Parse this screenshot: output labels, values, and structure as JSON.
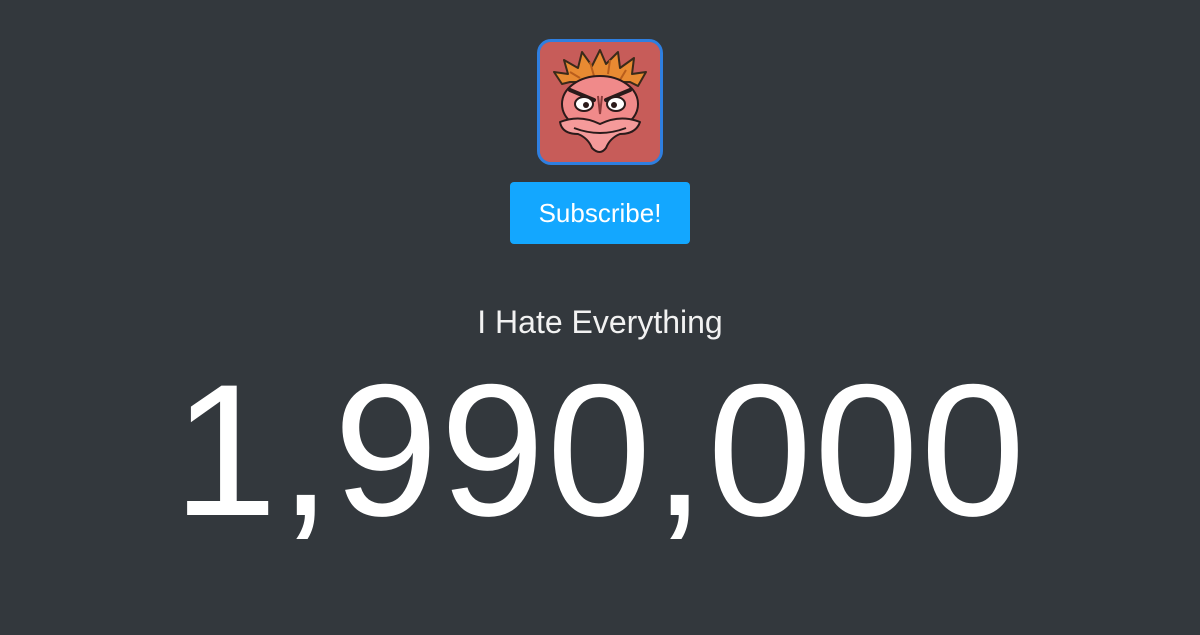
{
  "channel": {
    "avatar_icon": "angry-cartoon-face-avatar",
    "name": "I Hate Everything",
    "subscriber_count": "1,990,000"
  },
  "subscribe": {
    "label": "Subscribe!"
  },
  "colors": {
    "background": "#33383d",
    "button": "#13a7ff",
    "avatar_border": "#2f7fe0",
    "avatar_background": "#c45a57"
  }
}
